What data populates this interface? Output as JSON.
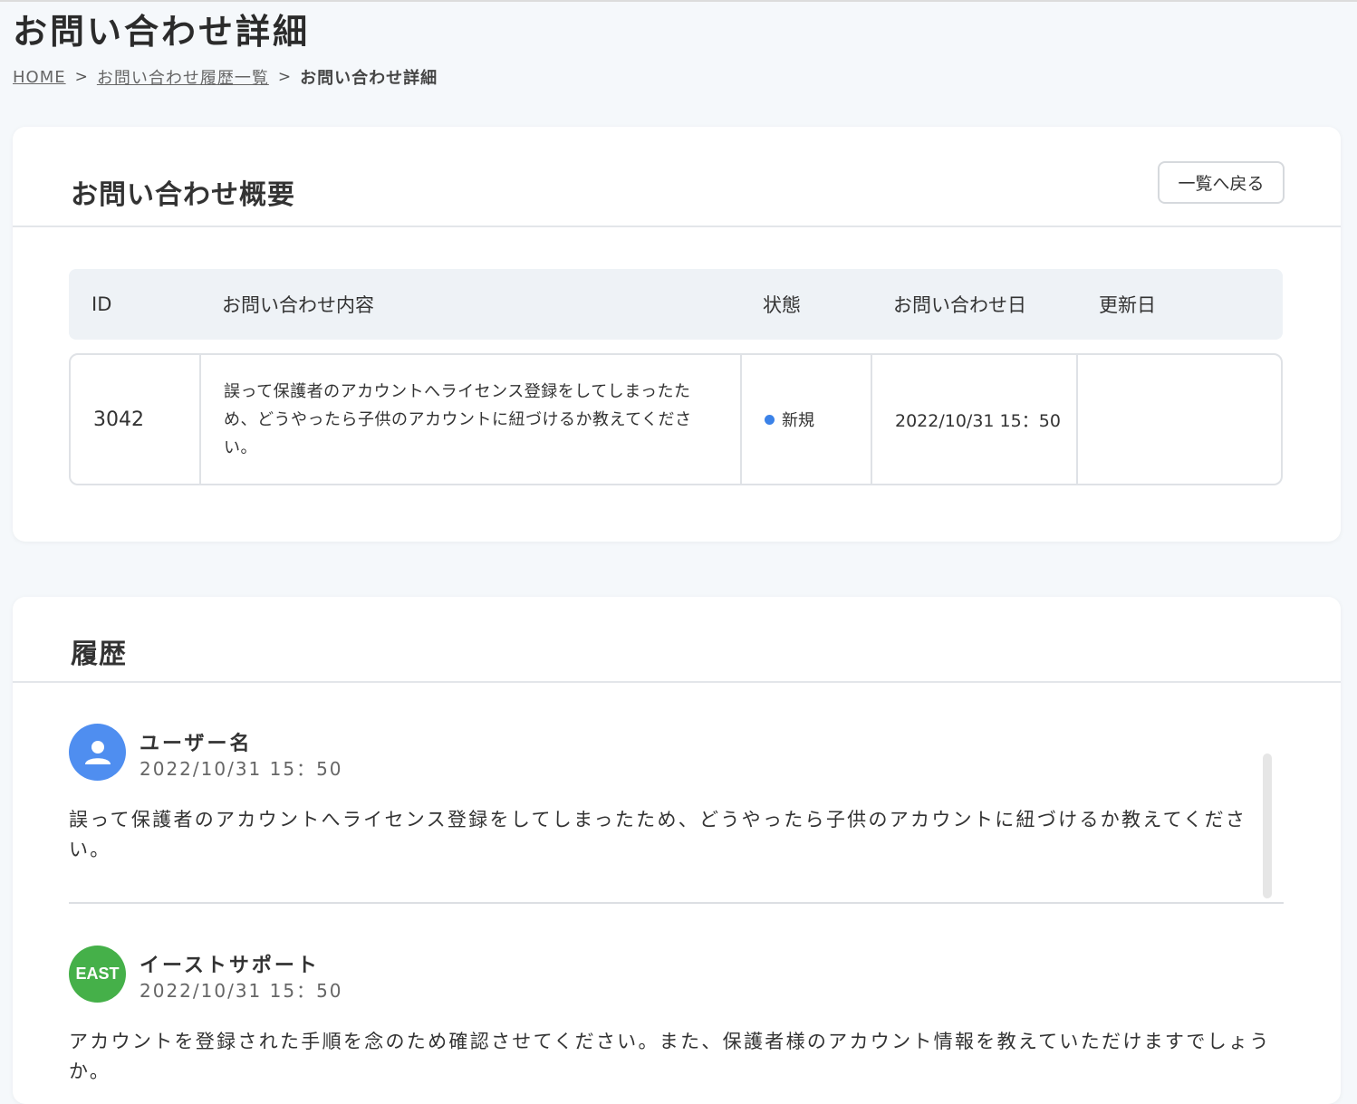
{
  "page": {
    "title": "お問い合わせ詳細"
  },
  "breadcrumb": {
    "home": "HOME",
    "history_list": "お問い合わせ履歴一覧",
    "current": "お問い合わせ詳細",
    "sep": ">"
  },
  "summary": {
    "title": "お問い合わせ概要",
    "back_button": "一覧へ戻る",
    "columns": [
      "ID",
      "お問い合わせ内容",
      "状態",
      "お問い合わせ日",
      "更新日"
    ],
    "row": {
      "id": "3042",
      "content": "誤って保護者のアカウントへライセンス登録をしてしまったため、どうやったら子供のアカウントに紐づけるか教えてください。",
      "status": "新規",
      "status_color": "#3b82e8",
      "date": "2022/10/31 15：50",
      "updated": ""
    }
  },
  "history": {
    "title": "履歴",
    "entries": [
      {
        "name": "ユーザー名",
        "date": "2022/10/31 15：50",
        "avatar_icon": "person-icon",
        "avatar_color": "#4f8ef0",
        "message": "誤って保護者のアカウントへライセンス登録をしてしまったため、どうやったら子供のアカウントに紐づけるか教えてください。"
      },
      {
        "name": "イーストサポート",
        "date": "2022/10/31 15：50",
        "avatar_text": "EAST",
        "avatar_color": "#45b049",
        "message": "アカウントを登録された手順を念のため確認させてください。また、保護者様のアカウント情報を教えていただけますでしょうか。"
      }
    ]
  }
}
